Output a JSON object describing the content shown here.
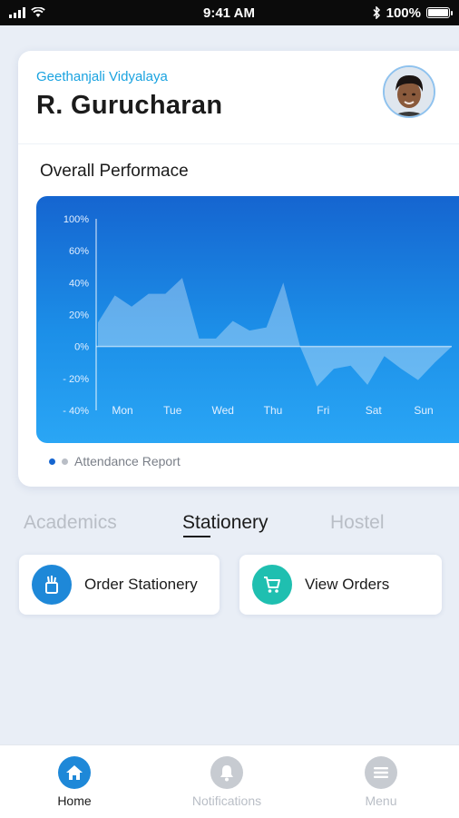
{
  "status_bar": {
    "time": "9:41 AM",
    "battery": "100%"
  },
  "profile": {
    "school": "Geethanjali Vidyalaya",
    "student_name": "R. Gurucharan"
  },
  "performance": {
    "title": "Overall Performace",
    "legend_label": "Attendance Report"
  },
  "chart_data": {
    "type": "area",
    "ylabels": [
      "100%",
      "60%",
      "40%",
      "20%",
      "0%",
      "- 20%",
      "- 40%"
    ],
    "categories": [
      "Mon",
      "Tue",
      "Wed",
      "Thu",
      "Fri",
      "Sat",
      "Sun"
    ],
    "series": [
      {
        "values": [
          15,
          32,
          25,
          33,
          33,
          43,
          5,
          5,
          16,
          10,
          12,
          40,
          0,
          -25,
          -14,
          -12,
          -24,
          -6,
          -14,
          -21,
          -10,
          0
        ]
      }
    ]
  },
  "tabs": [
    {
      "label": "Academics",
      "active": false
    },
    {
      "label": "Stationery",
      "active": true
    },
    {
      "label": "Hostel",
      "active": false
    }
  ],
  "actions": [
    {
      "label": "Order Stationery",
      "icon": "stationery-icon",
      "color": "#1e88d8"
    },
    {
      "label": "View Orders",
      "icon": "cart-icon",
      "color": "#1fbfb0"
    }
  ],
  "nav": [
    {
      "label": "Home",
      "icon": "home-icon",
      "active": true
    },
    {
      "label": "Notifications",
      "icon": "bell-icon",
      "active": false
    },
    {
      "label": "Menu",
      "icon": "menu-icon",
      "active": false
    }
  ],
  "colors": {
    "accent": "#1e88d8",
    "teal": "#1fbfb0",
    "inactive": "#b9bec6"
  }
}
